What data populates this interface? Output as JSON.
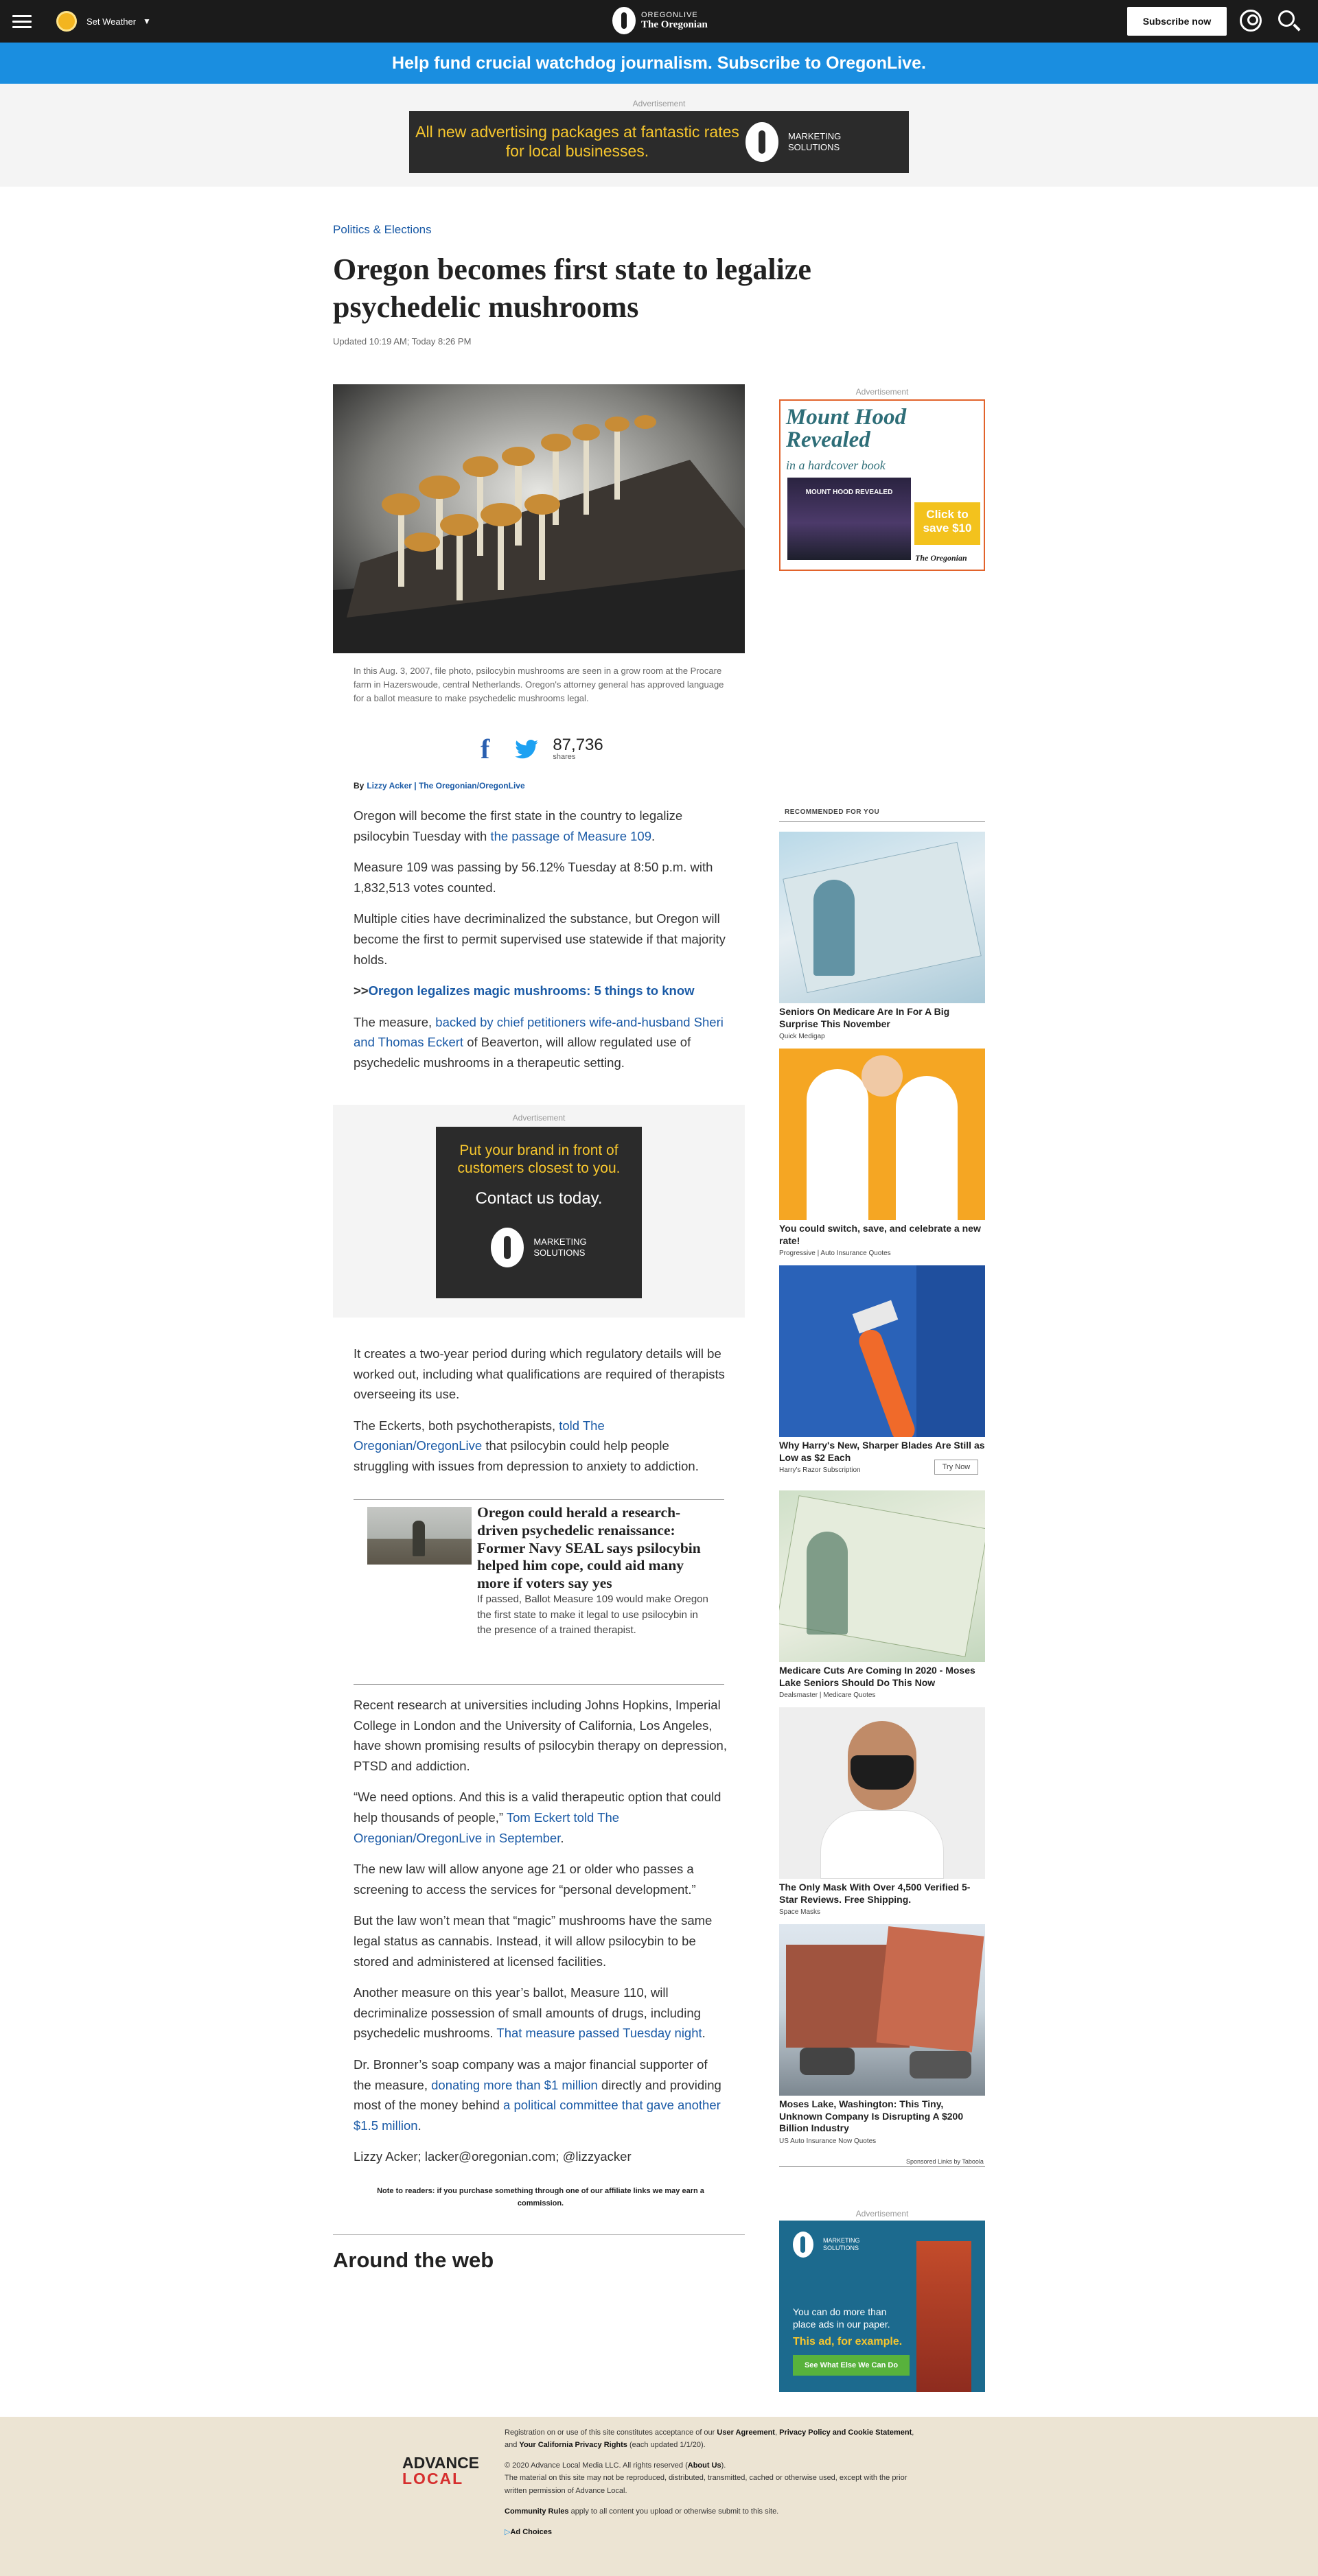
{
  "topbar": {
    "weather_label": "Set Weather",
    "logo_line1": "OREGONLIVE",
    "logo_line2": "The Oregonian",
    "subscribe_label": "Subscribe now"
  },
  "promo": {
    "text": "Help fund crucial watchdog journalism. Subscribe to OregonLive."
  },
  "ads": {
    "label": "Advertisement",
    "top_text": "All new advertising packages at fantastic rates for local businesses.",
    "marketing_line1": "MARKETING",
    "marketing_line2": "SOLUTIONS",
    "mid_yellow": "Put your brand in front of customers closest to you.",
    "mid_white": "Contact us today.",
    "side_title": "Mount Hood Revealed",
    "side_sub": "in a hardcover book",
    "side_book": "MOUNT HOOD REVEALED",
    "side_cta": "Click to save $10",
    "side_brand": "The Oregonian",
    "ms_text": "You can do more than place ads in our paper.",
    "ms_text2": "This ad, for example.",
    "ms_cta": "See What Else We Can Do"
  },
  "article": {
    "category": "Politics & Elections",
    "headline": "Oregon becomes first state to legalize psychedelic mushrooms",
    "updated": "Updated 10:19 AM; Today 8:26 PM",
    "caption": "In this Aug. 3, 2007, file photo, psilocybin mushrooms are seen in a grow room at the Procare farm in Hazerswoude, central Netherlands. Oregon's attorney general has approved language for a ballot measure to make psychedelic mushrooms legal.",
    "share_count": "87,736",
    "share_label": "shares",
    "byline_by": "By",
    "byline_author": "Lizzy Acker | The Oregonian/OregonLive",
    "p1_a": "Oregon will become the first state in the country to legalize psilocybin Tuesday with ",
    "p1_link": "the passage of Measure 109",
    "p1_b": ".",
    "p2": "Measure 109 was passing by 56.12% Tuesday at 8:50 p.m. with 1,832,513 votes counted.",
    "p3": "Multiple cities have decriminalized the substance, but Oregon will become the first to permit supervised use statewide if that majority holds.",
    "p4_prefix": ">>",
    "p4_link": "Oregon legalizes magic mushrooms: 5 things to know",
    "p5_a": "The measure, ",
    "p5_link": "backed by chief petitioners wife-and-husband Sheri and Thomas Eckert",
    "p5_b": " of Beaverton, will allow regulated use of psychedelic mushrooms in a therapeutic setting.",
    "p6": "It creates a two-year period during which regulatory details will be worked out, including what qualifications are required of therapists overseeing its use.",
    "p7_a": "The Eckerts, both psychotherapists, ",
    "p7_link": "told The Oregonian/OregonLive",
    "p7_b": " that psilocybin could help people struggling with issues from depression to anxiety to addiction.",
    "related_title": "Oregon could herald a research-driven psychedelic renaissance: Former Navy SEAL says psilocybin helped him cope, could aid many more if voters say yes",
    "related_desc": "If passed, Ballot Measure 109 would make Oregon the first state to make it legal to use psilocybin in the presence of a trained therapist.",
    "p8": "Recent research at universities including Johns Hopkins, Imperial College in London and the University of California, Los Angeles, have shown promising results of psilocybin therapy on depression, PTSD and addiction.",
    "p9_a": "“We need options. And this is a valid therapeutic option that could help thousands of people,” ",
    "p9_link": "Tom Eckert told The Oregonian/OregonLive in September",
    "p9_b": ".",
    "p10": "The new law will allow anyone age 21 or older who passes a screening to access the services for “personal development.”",
    "p11": "But the law won’t mean that “magic” mushrooms have the same legal status as cannabis. Instead, it will allow psilocybin to be stored and administered at licensed facilities.",
    "p12_a": "Another measure on this year’s ballot, Measure 110, will decriminalize possession of small amounts of drugs, including psychedelic mushrooms. ",
    "p12_link": "That measure passed Tuesday night",
    "p12_b": ".",
    "p13_a": "Dr. Bronner’s soap company was a major financial supporter of the measure, ",
    "p13_link1": "donating more than $1 million",
    "p13_b": " directly and providing most of the money behind ",
    "p13_link2": "a political committee that gave another $1.5 million",
    "p13_c": ".",
    "p14": "Lizzy Acker; lacker@oregonian.com; @lizzyacker",
    "note": "Note to readers: if you purchase something through one of our affiliate links we may earn a commission.",
    "around": "Around the web"
  },
  "sidebar": {
    "rec_title": "RECOMMENDED FOR YOU",
    "items": [
      {
        "headline": "Seniors On Medicare Are In For A Big Surprise This November",
        "source": "Quick Medigap"
      },
      {
        "headline": "You could switch, save, and celebrate a new rate!",
        "source": "Progressive | Auto Insurance Quotes"
      },
      {
        "headline": "Why Harry's New, Sharper Blades Are Still as Low as $2 Each",
        "source": "Harry's Razor Subscription",
        "cta": "Try Now"
      },
      {
        "headline": "Medicare Cuts Are Coming In 2020 - Moses Lake Seniors Should Do This Now",
        "source": "Dealsmaster | Medicare Quotes"
      },
      {
        "headline": "The Only Mask With Over 4,500 Verified 5-Star Reviews. Free Shipping.",
        "source": "Space Masks"
      },
      {
        "headline": "Moses Lake, Washington: This Tiny, Unknown Company Is Disrupting A $200 Billion Industry",
        "source": "US Auto Insurance Now Quotes"
      }
    ],
    "sponsored": "Sponsored Links by Taboola"
  },
  "footer": {
    "logo_advance": "ADVANCE",
    "logo_local": "LOCAL",
    "reg_a": "Registration on or use of this site constitutes acceptance of our ",
    "user_agreement": "User Agreement",
    "reg_b": ", ",
    "privacy": "Privacy Policy and Cookie Statement",
    "reg_c": ", and ",
    "ca_rights": "Your California Privacy Rights",
    "reg_d": " (each updated 1/1/20).",
    "copyright_a": "© 2020 Advance Local Media LLC. All rights reserved (",
    "about_us": "About Us",
    "copyright_b": ").",
    "material": "The material on this site may not be reproduced, distributed, transmitted, cached or otherwise used, except with the prior written permission of Advance Local.",
    "community_rules": "Community Rules",
    "community_b": " apply to all content you upload or otherwise submit to this site.",
    "ad_choices": "Ad Choices"
  }
}
